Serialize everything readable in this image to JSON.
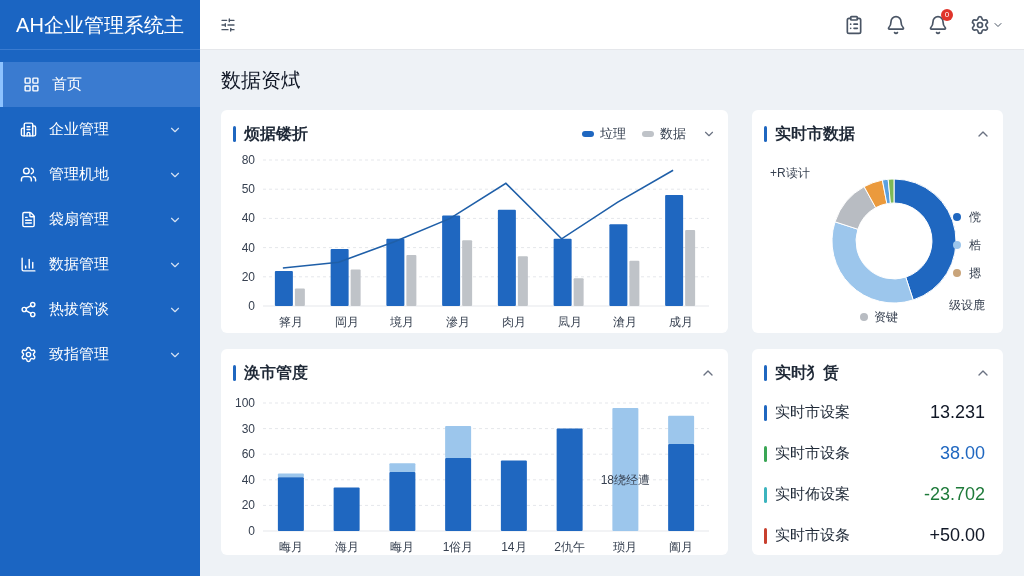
{
  "sidebar": {
    "brand": "AH企业管理系统主",
    "items": [
      {
        "label": "首页",
        "selected": true,
        "expandable": false
      },
      {
        "label": "企业管理",
        "selected": false,
        "expandable": true
      },
      {
        "label": "管理机地",
        "selected": false,
        "expandable": true
      },
      {
        "label": "袋扇管理",
        "selected": false,
        "expandable": true
      },
      {
        "label": "数据管理",
        "selected": false,
        "expandable": true
      },
      {
        "label": "热拔管谈",
        "selected": false,
        "expandable": true
      },
      {
        "label": "致指管理",
        "selected": false,
        "expandable": true
      }
    ]
  },
  "header": {
    "badge": "0"
  },
  "page_title": "数据资烒",
  "trend_card": {
    "title": "烦据镂折",
    "legend": [
      {
        "label": "垃理",
        "color": "#1f67c0"
      },
      {
        "label": "数据",
        "color": "#bfc3c8"
      }
    ],
    "y_labels": [
      "80",
      "50",
      "40",
      "40",
      "20",
      "0"
    ],
    "x_labels": [
      "箨月",
      "岡月",
      "境月",
      "滲月",
      "肉月",
      "凨月",
      "滄月",
      "成月"
    ]
  },
  "donut_card": {
    "title": "实时市数据",
    "callouts": [
      "+R读计",
      "级设鹿"
    ],
    "bottom_label": {
      "label": "资键",
      "color": "#b8bcc2"
    },
    "legend": [
      {
        "label": "傥",
        "color": "#1f67c0"
      },
      {
        "label": "梏",
        "color": "#9cc6ec"
      },
      {
        "label": "摁",
        "color": "#c9a47a"
      }
    ]
  },
  "progress_card": {
    "title": "涣市管度",
    "annotation": "18绕经遭",
    "y_labels": [
      "100",
      "30",
      "60",
      "40",
      "20",
      "0"
    ],
    "x_labels": [
      "晦月",
      "海月",
      "晦月",
      "1俗月",
      "14月",
      "2仇午",
      "琐月",
      "阖月"
    ]
  },
  "stats_card": {
    "title": "实时犭赁",
    "rows": [
      {
        "label": "实时市设案",
        "value": "13.231",
        "color": "#1f67c0",
        "kind": "neutral"
      },
      {
        "label": "实时市设条",
        "value": "38.00",
        "color": "#3aa655",
        "kind": "blue"
      },
      {
        "label": "实时佈设案",
        "value": "-23.702",
        "color": "#3cb4be",
        "kind": "green"
      },
      {
        "label": "实时市设条",
        "value": "+50.00",
        "color": "#c8402f",
        "kind": "neutral"
      }
    ]
  }
}
